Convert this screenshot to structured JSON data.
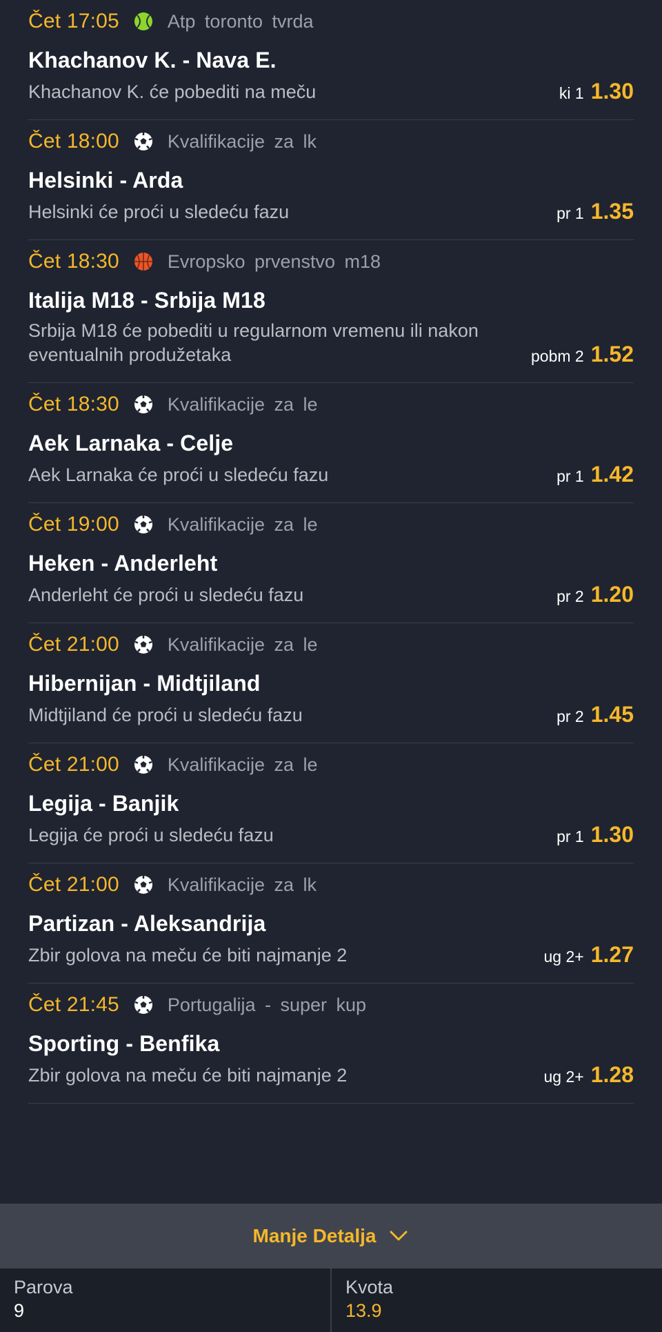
{
  "colors": {
    "background": "#1f2430",
    "accent": "#f6b72a",
    "divider": "#3a3f4b",
    "footer_bg": "#1b1f28",
    "details_bg": "#40444f"
  },
  "matches": [
    {
      "time": "Čet 17:05",
      "sport_icon": "tennis-ball-icon",
      "league": "Atp toronto tvrda",
      "teams": "Khachanov K. - Nava E.",
      "desc": "Khachanov K. će pobediti na meču",
      "bet_code": "ki 1",
      "odd": "1.30"
    },
    {
      "time": "Čet 18:00",
      "sport_icon": "soccer-ball-icon",
      "league": "Kvalifikacije za lk",
      "teams": "Helsinki - Arda",
      "desc": "Helsinki će proći u sledeću fazu",
      "bet_code": "pr 1",
      "odd": "1.35"
    },
    {
      "time": "Čet 18:30",
      "sport_icon": "basketball-icon",
      "league": "Evropsko prvenstvo m18",
      "teams": "Italija M18 - Srbija M18",
      "desc": "Srbija M18 će pobediti u regularnom vremenu ili nakon eventualnih produžetaka",
      "bet_code": "pobm 2",
      "odd": "1.52"
    },
    {
      "time": "Čet 18:30",
      "sport_icon": "soccer-ball-icon",
      "league": "Kvalifikacije za le",
      "teams": "Aek Larnaka - Celje",
      "desc": "Aek Larnaka će proći u sledeću fazu",
      "bet_code": "pr 1",
      "odd": "1.42"
    },
    {
      "time": "Čet 19:00",
      "sport_icon": "soccer-ball-icon",
      "league": "Kvalifikacije za le",
      "teams": "Heken - Anderleht",
      "desc": "Anderleht će proći u sledeću fazu",
      "bet_code": "pr 2",
      "odd": "1.20"
    },
    {
      "time": "Čet 21:00",
      "sport_icon": "soccer-ball-icon",
      "league": "Kvalifikacije za le",
      "teams": "Hibernijan - Midtjiland",
      "desc": "Midtjiland će proći u sledeću fazu",
      "bet_code": "pr 2",
      "odd": "1.45"
    },
    {
      "time": "Čet 21:00",
      "sport_icon": "soccer-ball-icon",
      "league": "Kvalifikacije za le",
      "teams": "Legija - Banjik",
      "desc": "Legija će proći u sledeću fazu",
      "bet_code": "pr 1",
      "odd": "1.30"
    },
    {
      "time": "Čet 21:00",
      "sport_icon": "soccer-ball-icon",
      "league": "Kvalifikacije za lk",
      "teams": "Partizan - Aleksandrija",
      "desc": "Zbir golova na meču će biti najmanje 2",
      "bet_code": "ug 2+",
      "odd": "1.27"
    },
    {
      "time": "Čet 21:45",
      "sport_icon": "soccer-ball-icon",
      "league": "Portugalija - super kup",
      "teams": "Sporting - Benfika",
      "desc": "Zbir golova na meču će biti najmanje 2",
      "bet_code": "ug 2+",
      "odd": "1.28"
    }
  ],
  "details_toggle": {
    "label": "Manje Detalja",
    "icon": "chevron-down-icon"
  },
  "footer": {
    "pairs_label": "Parova",
    "pairs_value": "9",
    "odds_label": "Kvota",
    "odds_value": "13.9"
  }
}
